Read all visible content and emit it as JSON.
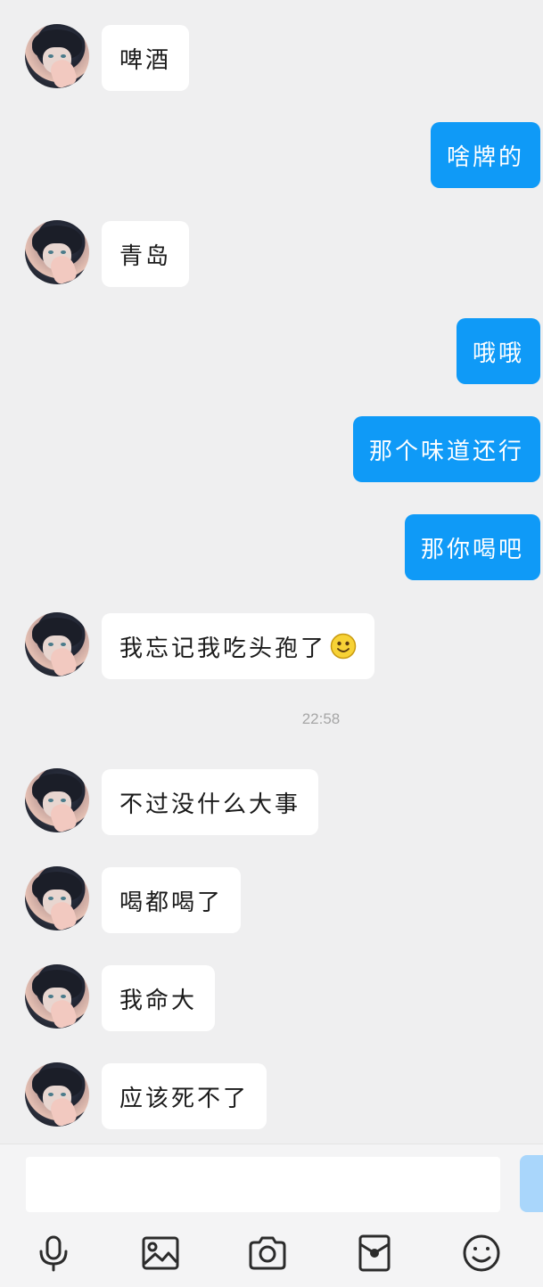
{
  "messages": [
    {
      "side": "left",
      "text": "啤酒"
    },
    {
      "side": "right",
      "text": "啥牌的"
    },
    {
      "side": "left",
      "text": "青岛"
    },
    {
      "side": "right",
      "text": "哦哦"
    },
    {
      "side": "right",
      "text": "那个味道还行"
    },
    {
      "side": "right",
      "text": "那你喝吧"
    },
    {
      "side": "left",
      "text": "我忘记我吃头孢了",
      "emoji": "smile-emoji"
    },
    {
      "side": "left",
      "text": "不过没什么大事"
    },
    {
      "side": "left",
      "text": "喝都喝了"
    },
    {
      "side": "left",
      "text": "我命大"
    },
    {
      "side": "left",
      "text": "应该死不了"
    }
  ],
  "timestamp": "22:58",
  "input": {
    "value": "",
    "placeholder": ""
  },
  "toolbar": {
    "icons": [
      "microphone-icon",
      "image-icon",
      "camera-icon",
      "red-packet-icon",
      "emoji-icon"
    ]
  },
  "colors": {
    "background": "#efeff0",
    "sent_bubble": "#0f9af7",
    "received_bubble": "#ffffff",
    "send_button": "#a9d6fb",
    "timestamp": "#a6a6a6",
    "icon": "#2b2b2b"
  }
}
